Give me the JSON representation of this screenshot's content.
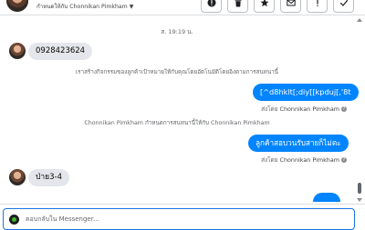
{
  "header": {
    "assign_label": "กำหนดให้กับ Chonnikan Pimkham",
    "toolbar": [
      {
        "name": "info",
        "icon": "exclamation-circle-icon"
      },
      {
        "name": "delete",
        "icon": "trash-icon"
      },
      {
        "name": "star",
        "icon": "star-icon"
      },
      {
        "name": "mark-unread",
        "icon": "envelope-icon"
      },
      {
        "name": "report",
        "icon": "exclamation-icon"
      },
      {
        "name": "done",
        "icon": "check-icon"
      }
    ]
  },
  "thread": {
    "date_separator": "ส. 19:19 น.",
    "messages": {
      "in_1": "0928423624",
      "sys_1": "เราสร้างกิจกรรมของลูกค้าเป้าหมายให้กับคุณโดยอัตโนมัติโดยอิงตามการสนทนานี้",
      "out_1": "[^d8hklt[;diy[[kpduj[,'8t",
      "sentby_1_prefix": "ส่งโดย",
      "sentby_1_name": "Chonnikan Pimkham",
      "sys_2": "Chonnikan Pimkham กำหนดการสนทนานี้ให้กับ Chonnikan Pimkham",
      "out_2": "ลูกค้าสอบวนรับสายก็ไม่ตะ",
      "sentby_2_prefix": "ส่งโดย",
      "sentby_2_name": "Chonnikan Pimkham",
      "in_2": "ป่าย3-4"
    }
  },
  "composer": {
    "placeholder": "ตอบกลับใน Messenger..."
  },
  "colors": {
    "outgoing_bubble": "#0084ff",
    "incoming_bubble": "#e4e6eb",
    "input_border": "#1b74e4"
  }
}
